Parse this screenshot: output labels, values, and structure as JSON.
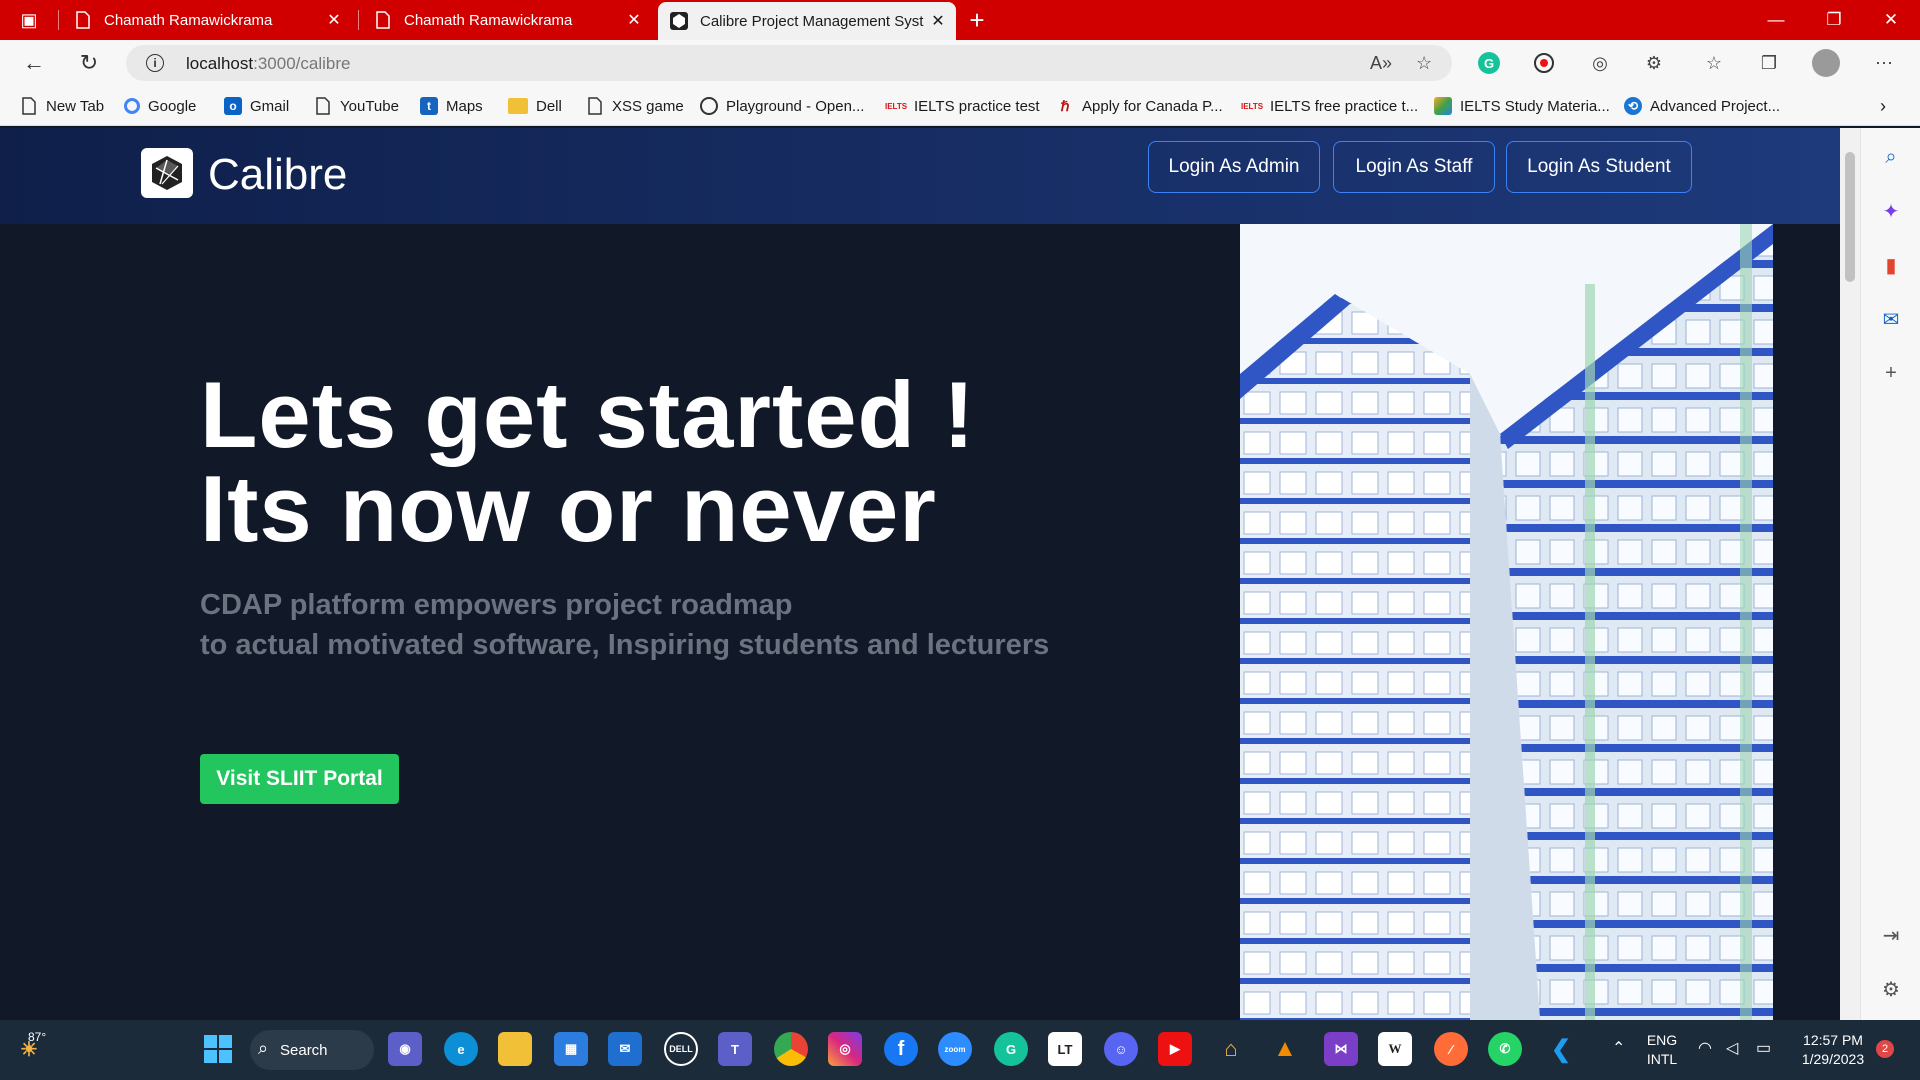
{
  "browser": {
    "tabs": [
      {
        "title": "Chamath Ramawickrama",
        "active": false
      },
      {
        "title": "Chamath Ramawickrama",
        "active": false
      },
      {
        "title": "Calibre Project Management Syst",
        "active": true
      }
    ],
    "new_tab_symbol": "+",
    "window_controls": {
      "minimize": "—",
      "restore": "❐",
      "close": "✕"
    },
    "address_bar": {
      "host": "localhost",
      "path": ":3000/calibre"
    },
    "bookmarks": [
      {
        "label": "New Tab",
        "icon": "page-icon"
      },
      {
        "label": "Google",
        "icon": "google-icon"
      },
      {
        "label": "Gmail",
        "icon": "outlook-icon"
      },
      {
        "label": "YouTube",
        "icon": "page-icon"
      },
      {
        "label": "Maps",
        "icon": "maps-icon"
      },
      {
        "label": "Dell",
        "icon": "folder-icon"
      },
      {
        "label": "XSS game",
        "icon": "page-icon"
      },
      {
        "label": "Playground - Open...",
        "icon": "openai-icon"
      },
      {
        "label": "IELTS practice test",
        "icon": "ielts-icon"
      },
      {
        "label": "Apply for Canada P...",
        "icon": "canada-icon"
      },
      {
        "label": "IELTS free practice t...",
        "icon": "ielts-icon"
      },
      {
        "label": "IELTS Study Materia...",
        "icon": "study-icon"
      },
      {
        "label": "Advanced Project...",
        "icon": "project-icon"
      }
    ]
  },
  "site": {
    "brand": "Calibre",
    "header_buttons": [
      "Login As Admin",
      "Login As Staff",
      "Login As Student"
    ],
    "hero": {
      "title_line1": "Lets get started !",
      "title_line2": "Its now or never",
      "subtitle_line1": "CDAP platform empowers project roadmap",
      "subtitle_line2": "to actual motivated software, Inspiring students and lecturers",
      "cta": "Visit SLIIT Portal"
    },
    "colors": {
      "header": "#1e3a7b",
      "background": "#111827",
      "cta": "#22c55e",
      "button_border": "#3b82f6"
    }
  },
  "taskbar": {
    "weather": "87°",
    "search_label": "Search",
    "language": "ENG",
    "layout": "INTL",
    "time": "12:57 PM",
    "date": "1/29/2023",
    "notifications": "2"
  }
}
